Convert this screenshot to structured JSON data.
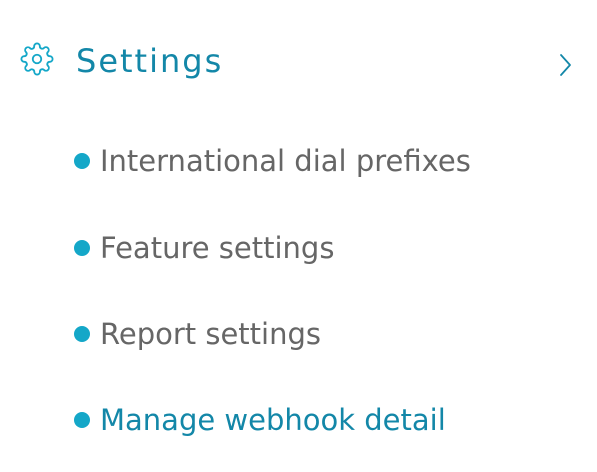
{
  "menu": {
    "title": "Settings",
    "icon": "gear-icon",
    "expand_icon": "chevron-right-icon",
    "items": [
      {
        "label": "International dial prefixes",
        "active": false
      },
      {
        "label": "Feature settings",
        "active": false
      },
      {
        "label": "Report settings",
        "active": false
      },
      {
        "label": "Manage webhook detail",
        "active": true
      }
    ]
  },
  "colors": {
    "accent": "#1387a8",
    "bullet": "#14a7c8",
    "text": "#666666",
    "background": "#ffffff"
  }
}
